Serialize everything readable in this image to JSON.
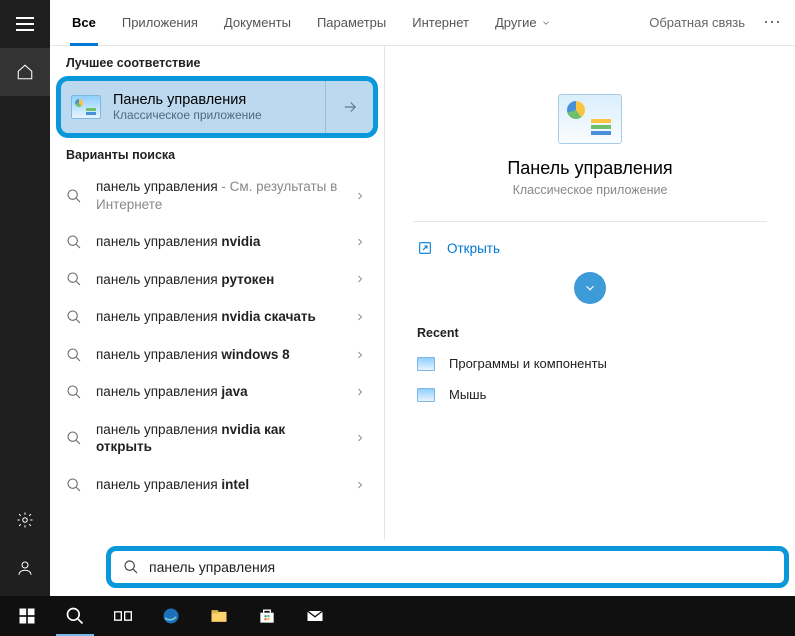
{
  "tabs": {
    "items": [
      {
        "label": "Все",
        "active": true
      },
      {
        "label": "Приложения"
      },
      {
        "label": "Документы"
      },
      {
        "label": "Параметры"
      },
      {
        "label": "Интернет"
      },
      {
        "label": "Другие",
        "dropdown": true
      }
    ],
    "feedback": "Обратная связь"
  },
  "sections": {
    "best_match": "Лучшее соответствие",
    "search_variants": "Варианты поиска"
  },
  "best_match": {
    "title": "Панель управления",
    "subtitle": "Классическое приложение"
  },
  "suggestions": [
    {
      "prefix": "панель управления",
      "suffix": "",
      "note": " - См. результаты в Интернете"
    },
    {
      "prefix": "панель управления ",
      "suffix": "nvidia"
    },
    {
      "prefix": "панель управления ",
      "suffix": "рутокен"
    },
    {
      "prefix": "панель управления ",
      "suffix": "nvidia скачать"
    },
    {
      "prefix": "панель управления ",
      "suffix": "windows 8"
    },
    {
      "prefix": "панель управления ",
      "suffix": "java"
    },
    {
      "prefix": "панель управления ",
      "suffix": "nvidia как открыть"
    },
    {
      "prefix": "панель управления ",
      "suffix": "intel"
    }
  ],
  "preview": {
    "title": "Панель управления",
    "subtitle": "Классическое приложение",
    "open": "Открыть",
    "recent_label": "Recent",
    "recent": [
      {
        "label": "Программы и компоненты"
      },
      {
        "label": "Мышь"
      }
    ]
  },
  "search": {
    "value": "панель управления"
  }
}
